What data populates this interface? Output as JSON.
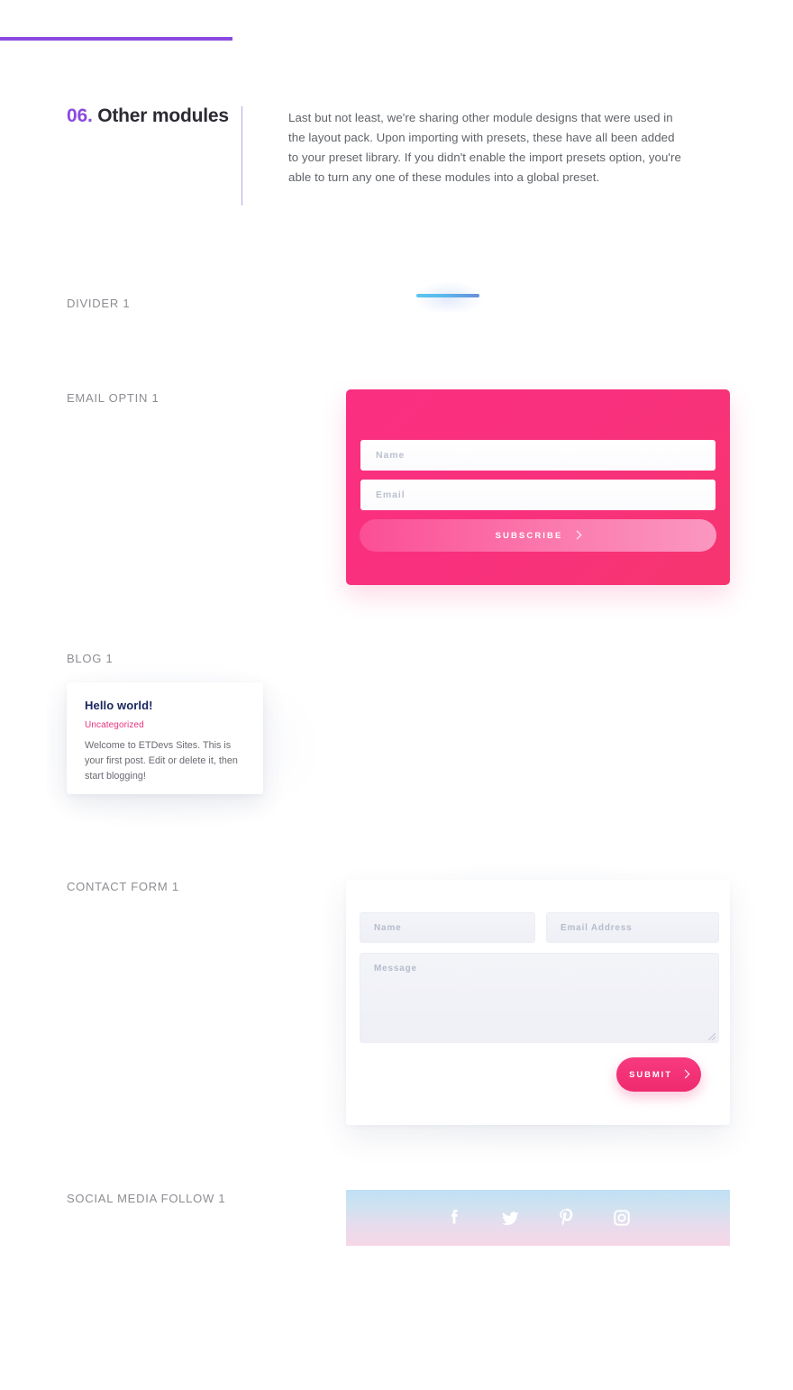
{
  "accent": {
    "purple": "#8b49e0",
    "pink": "#f9307e",
    "pink_dark": "#ef2a6e",
    "blue": "#5cc6ee",
    "navy": "#17265c",
    "label_gray": "#8d8d93",
    "body_gray": "#5f6368"
  },
  "intro": {
    "number": "06.",
    "title": " Other modules",
    "body": "Last but not least, we're sharing other module designs that were used in the layout pack. Upon importing with presets, these have all been added to your preset library. If you didn't enable the import presets option, you're able to turn any one of these modules into a global preset."
  },
  "sections": {
    "divider": {
      "label": "DIVIDER 1"
    },
    "optin": {
      "label": "EMAIL OPTIN 1",
      "name_placeholder": "Name",
      "email_placeholder": "Email",
      "button_label": "SUBSCRIBE"
    },
    "blog": {
      "label": "BLOG 1",
      "post_title": "Hello world!",
      "post_category": "Uncategorized",
      "post_excerpt": "Welcome to ETDevs Sites. This is your first post. Edit or delete it, then start blogging!"
    },
    "contact": {
      "label": "CONTACT FORM 1",
      "name_placeholder": "Name",
      "email_placeholder": "Email Address",
      "message_placeholder": "Message",
      "button_label": "SUBMIT"
    },
    "social": {
      "label": "SOCIAL MEDIA FOLLOW 1",
      "icons": [
        {
          "name": "facebook-icon"
        },
        {
          "name": "twitter-icon"
        },
        {
          "name": "pinterest-icon"
        },
        {
          "name": "instagram-icon"
        }
      ]
    }
  }
}
